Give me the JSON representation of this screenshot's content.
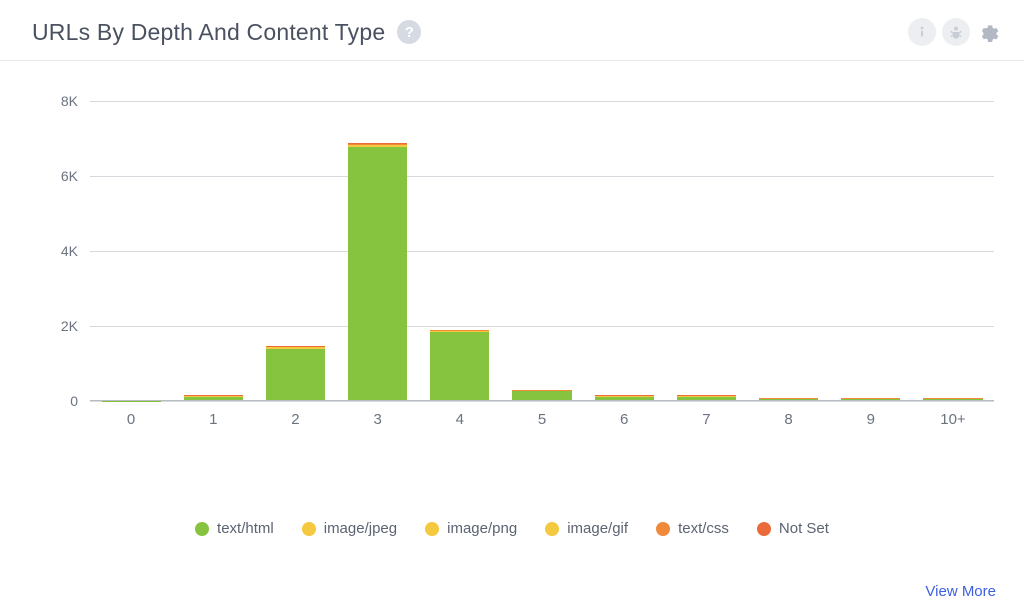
{
  "header": {
    "title": "URLs By Depth And Content Type",
    "help_glyph": "?"
  },
  "footer": {
    "view_more": "View More"
  },
  "chart_data": {
    "type": "bar",
    "stacked": true,
    "title": "URLs By Depth And Content Type",
    "xlabel": "",
    "ylabel": "",
    "ylim": [
      0,
      8000
    ],
    "y_ticks": [
      0,
      2000,
      4000,
      6000,
      8000
    ],
    "y_tick_labels": [
      "0",
      "2K",
      "4K",
      "6K",
      "8K"
    ],
    "categories": [
      "0",
      "1",
      "2",
      "3",
      "4",
      "5",
      "6",
      "7",
      "8",
      "9",
      "10+"
    ],
    "grid": true,
    "legend_position": "bottom",
    "series": [
      {
        "name": "text/html",
        "color": "#86c440",
        "values": [
          5,
          110,
          1380,
          6780,
          1840,
          260,
          120,
          120,
          55,
          55,
          55
        ]
      },
      {
        "name": "image/jpeg",
        "color": "#f4c93f",
        "values": [
          0,
          10,
          20,
          20,
          10,
          10,
          10,
          10,
          5,
          5,
          5
        ]
      },
      {
        "name": "image/png",
        "color": "#f4c93f",
        "values": [
          0,
          10,
          20,
          20,
          10,
          5,
          5,
          5,
          5,
          5,
          5
        ]
      },
      {
        "name": "image/gif",
        "color": "#f4c93f",
        "values": [
          0,
          5,
          10,
          10,
          5,
          5,
          5,
          5,
          0,
          0,
          0
        ]
      },
      {
        "name": "text/css",
        "color": "#f08a3b",
        "values": [
          0,
          10,
          20,
          30,
          20,
          10,
          5,
          5,
          5,
          5,
          5
        ]
      },
      {
        "name": "Not Set",
        "color": "#eb6a3a",
        "values": [
          0,
          5,
          10,
          20,
          10,
          5,
          5,
          5,
          5,
          5,
          5
        ]
      }
    ]
  }
}
